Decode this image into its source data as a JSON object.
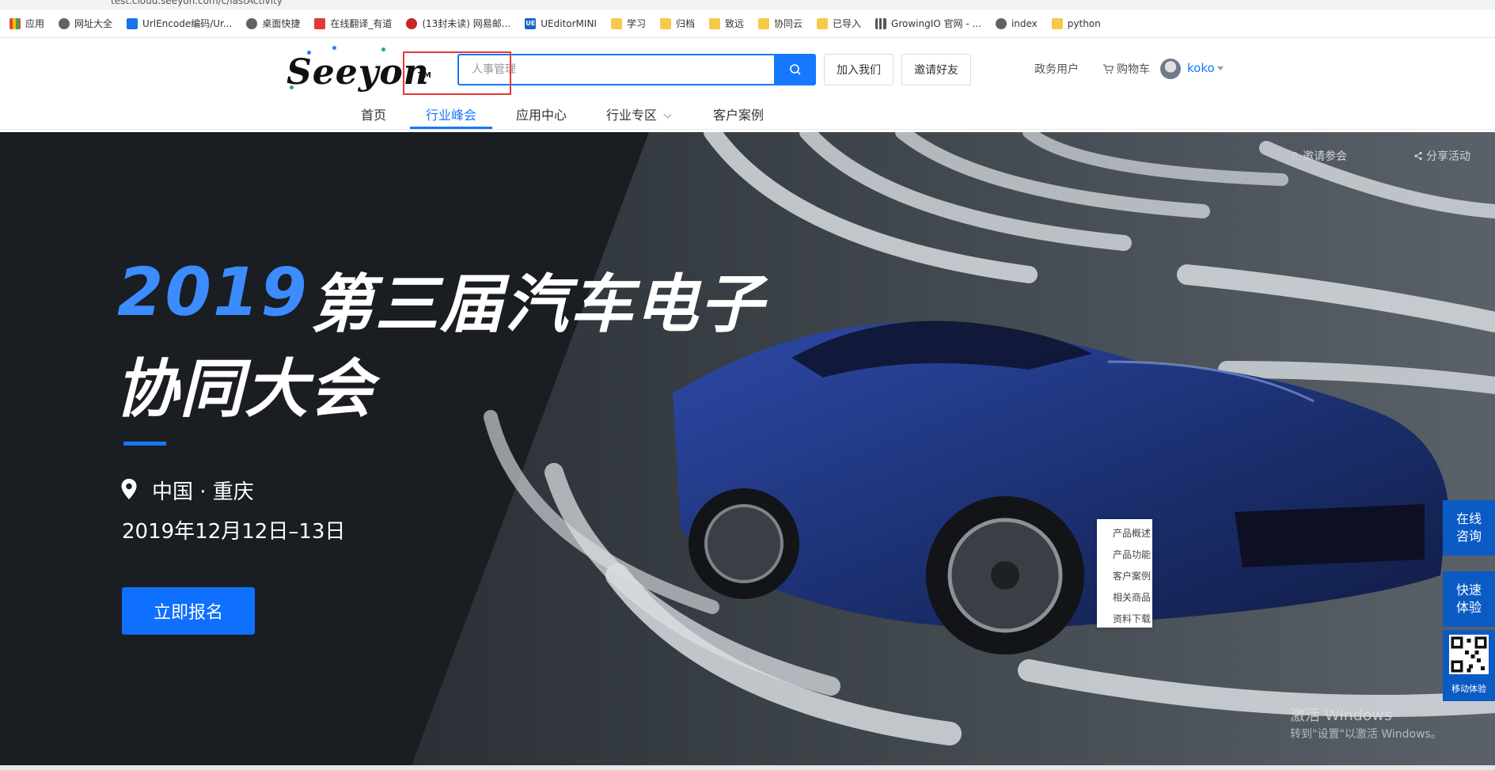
{
  "browser": {
    "url": "test.cloud.seeyon.com/c/lastActivity"
  },
  "bookmarks": [
    {
      "label": "应用",
      "icon": "apps-grid-icon"
    },
    {
      "label": "网址大全",
      "icon": "globe-icon"
    },
    {
      "label": "UrlEncode编码/Ur...",
      "icon": "bookmark-page-icon"
    },
    {
      "label": "桌面快捷",
      "icon": "globe-icon"
    },
    {
      "label": "在线翻译_有道",
      "icon": "youdao-icon"
    },
    {
      "label": "(13封未读) 网易邮...",
      "icon": "netease-mail-icon"
    },
    {
      "label": "UEditorMINI",
      "icon": "ue-icon"
    },
    {
      "label": "学习",
      "icon": "folder-icon"
    },
    {
      "label": "归档",
      "icon": "folder-icon"
    },
    {
      "label": "致远",
      "icon": "folder-icon"
    },
    {
      "label": "协同云",
      "icon": "folder-icon"
    },
    {
      "label": "已导入",
      "icon": "folder-icon"
    },
    {
      "label": "GrowingIO 官网 - ...",
      "icon": "growingio-icon"
    },
    {
      "label": "index",
      "icon": "page-icon"
    },
    {
      "label": "python",
      "icon": "folder-icon"
    }
  ],
  "header": {
    "logo_text": "Seeyon",
    "logo_tm": "TM",
    "search_placeholder": "人事管理",
    "join_label": "加入我们",
    "invite_label": "邀请好友",
    "gov_label": "政务用户",
    "cart_label": "购物车",
    "username": "koko"
  },
  "nav": {
    "items": [
      "首页",
      "行业峰会",
      "应用中心",
      "行业专区",
      "客户案例"
    ],
    "active_index": 1
  },
  "banner": {
    "year": "2019",
    "title_line1": "第三届汽车电子",
    "title_line2": "协同大会",
    "location": "中国 · 重庆",
    "date": "2019年12月12日–13日",
    "cta": "立即报名",
    "invite_link": "邀请参会",
    "share_link": "分享活动"
  },
  "side_menu": [
    "产品概述",
    "产品功能",
    "客户案例",
    "相关商品",
    "资料下载"
  ],
  "float": {
    "consult": "在线咨询",
    "experience": "快速体验",
    "mobile": "移动体验"
  },
  "watermark": {
    "line1": "激活 Windows",
    "line2": "转到\"设置\"以激活 Windows。"
  },
  "colors": {
    "accent": "#1677ff",
    "highlight_box": "#e53935",
    "float_bg": "#0b5bc4"
  }
}
